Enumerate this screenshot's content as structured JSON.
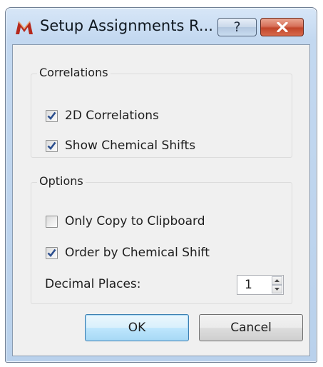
{
  "window": {
    "title": "Setup Assignments R...",
    "help_label": "?",
    "icons": {
      "app": "mnova-m-icon",
      "help": "help-icon",
      "close": "close-icon"
    }
  },
  "correlations": {
    "title": "Correlations",
    "items": [
      {
        "label": "2D Correlations",
        "checked": true
      },
      {
        "label": "Show Chemical Shifts",
        "checked": true
      }
    ]
  },
  "options": {
    "title": "Options",
    "items": [
      {
        "label": "Only Copy to Clipboard",
        "checked": false
      },
      {
        "label": "Order by Chemical Shift",
        "checked": true
      }
    ],
    "decimal_label": "Decimal Places:",
    "decimal_value": "1"
  },
  "buttons": {
    "ok": "OK",
    "cancel": "Cancel"
  },
  "colors": {
    "check": "#2c4f8f",
    "close_button": "#c9462b",
    "frame": "#c3d8f0",
    "client": "#f0f0f0"
  }
}
